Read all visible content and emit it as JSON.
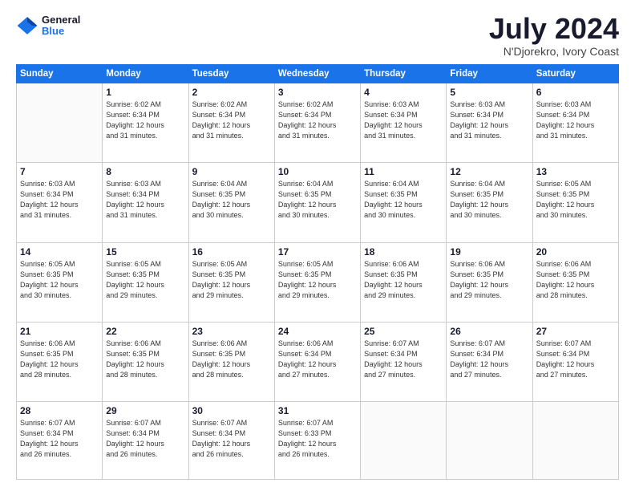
{
  "header": {
    "logo_line1": "General",
    "logo_line2": "Blue",
    "month_year": "July 2024",
    "location": "N'Djorekro, Ivory Coast"
  },
  "days_of_week": [
    "Sunday",
    "Monday",
    "Tuesday",
    "Wednesday",
    "Thursday",
    "Friday",
    "Saturday"
  ],
  "weeks": [
    [
      {
        "day": "",
        "info": ""
      },
      {
        "day": "1",
        "info": "Sunrise: 6:02 AM\nSunset: 6:34 PM\nDaylight: 12 hours\nand 31 minutes."
      },
      {
        "day": "2",
        "info": "Sunrise: 6:02 AM\nSunset: 6:34 PM\nDaylight: 12 hours\nand 31 minutes."
      },
      {
        "day": "3",
        "info": "Sunrise: 6:02 AM\nSunset: 6:34 PM\nDaylight: 12 hours\nand 31 minutes."
      },
      {
        "day": "4",
        "info": "Sunrise: 6:03 AM\nSunset: 6:34 PM\nDaylight: 12 hours\nand 31 minutes."
      },
      {
        "day": "5",
        "info": "Sunrise: 6:03 AM\nSunset: 6:34 PM\nDaylight: 12 hours\nand 31 minutes."
      },
      {
        "day": "6",
        "info": "Sunrise: 6:03 AM\nSunset: 6:34 PM\nDaylight: 12 hours\nand 31 minutes."
      }
    ],
    [
      {
        "day": "7",
        "info": "Sunrise: 6:03 AM\nSunset: 6:34 PM\nDaylight: 12 hours\nand 31 minutes."
      },
      {
        "day": "8",
        "info": "Sunrise: 6:03 AM\nSunset: 6:34 PM\nDaylight: 12 hours\nand 31 minutes."
      },
      {
        "day": "9",
        "info": "Sunrise: 6:04 AM\nSunset: 6:35 PM\nDaylight: 12 hours\nand 30 minutes."
      },
      {
        "day": "10",
        "info": "Sunrise: 6:04 AM\nSunset: 6:35 PM\nDaylight: 12 hours\nand 30 minutes."
      },
      {
        "day": "11",
        "info": "Sunrise: 6:04 AM\nSunset: 6:35 PM\nDaylight: 12 hours\nand 30 minutes."
      },
      {
        "day": "12",
        "info": "Sunrise: 6:04 AM\nSunset: 6:35 PM\nDaylight: 12 hours\nand 30 minutes."
      },
      {
        "day": "13",
        "info": "Sunrise: 6:05 AM\nSunset: 6:35 PM\nDaylight: 12 hours\nand 30 minutes."
      }
    ],
    [
      {
        "day": "14",
        "info": "Sunrise: 6:05 AM\nSunset: 6:35 PM\nDaylight: 12 hours\nand 30 minutes."
      },
      {
        "day": "15",
        "info": "Sunrise: 6:05 AM\nSunset: 6:35 PM\nDaylight: 12 hours\nand 29 minutes."
      },
      {
        "day": "16",
        "info": "Sunrise: 6:05 AM\nSunset: 6:35 PM\nDaylight: 12 hours\nand 29 minutes."
      },
      {
        "day": "17",
        "info": "Sunrise: 6:05 AM\nSunset: 6:35 PM\nDaylight: 12 hours\nand 29 minutes."
      },
      {
        "day": "18",
        "info": "Sunrise: 6:06 AM\nSunset: 6:35 PM\nDaylight: 12 hours\nand 29 minutes."
      },
      {
        "day": "19",
        "info": "Sunrise: 6:06 AM\nSunset: 6:35 PM\nDaylight: 12 hours\nand 29 minutes."
      },
      {
        "day": "20",
        "info": "Sunrise: 6:06 AM\nSunset: 6:35 PM\nDaylight: 12 hours\nand 28 minutes."
      }
    ],
    [
      {
        "day": "21",
        "info": "Sunrise: 6:06 AM\nSunset: 6:35 PM\nDaylight: 12 hours\nand 28 minutes."
      },
      {
        "day": "22",
        "info": "Sunrise: 6:06 AM\nSunset: 6:35 PM\nDaylight: 12 hours\nand 28 minutes."
      },
      {
        "day": "23",
        "info": "Sunrise: 6:06 AM\nSunset: 6:35 PM\nDaylight: 12 hours\nand 28 minutes."
      },
      {
        "day": "24",
        "info": "Sunrise: 6:06 AM\nSunset: 6:34 PM\nDaylight: 12 hours\nand 27 minutes."
      },
      {
        "day": "25",
        "info": "Sunrise: 6:07 AM\nSunset: 6:34 PM\nDaylight: 12 hours\nand 27 minutes."
      },
      {
        "day": "26",
        "info": "Sunrise: 6:07 AM\nSunset: 6:34 PM\nDaylight: 12 hours\nand 27 minutes."
      },
      {
        "day": "27",
        "info": "Sunrise: 6:07 AM\nSunset: 6:34 PM\nDaylight: 12 hours\nand 27 minutes."
      }
    ],
    [
      {
        "day": "28",
        "info": "Sunrise: 6:07 AM\nSunset: 6:34 PM\nDaylight: 12 hours\nand 26 minutes."
      },
      {
        "day": "29",
        "info": "Sunrise: 6:07 AM\nSunset: 6:34 PM\nDaylight: 12 hours\nand 26 minutes."
      },
      {
        "day": "30",
        "info": "Sunrise: 6:07 AM\nSunset: 6:34 PM\nDaylight: 12 hours\nand 26 minutes."
      },
      {
        "day": "31",
        "info": "Sunrise: 6:07 AM\nSunset: 6:33 PM\nDaylight: 12 hours\nand 26 minutes."
      },
      {
        "day": "",
        "info": ""
      },
      {
        "day": "",
        "info": ""
      },
      {
        "day": "",
        "info": ""
      }
    ]
  ]
}
